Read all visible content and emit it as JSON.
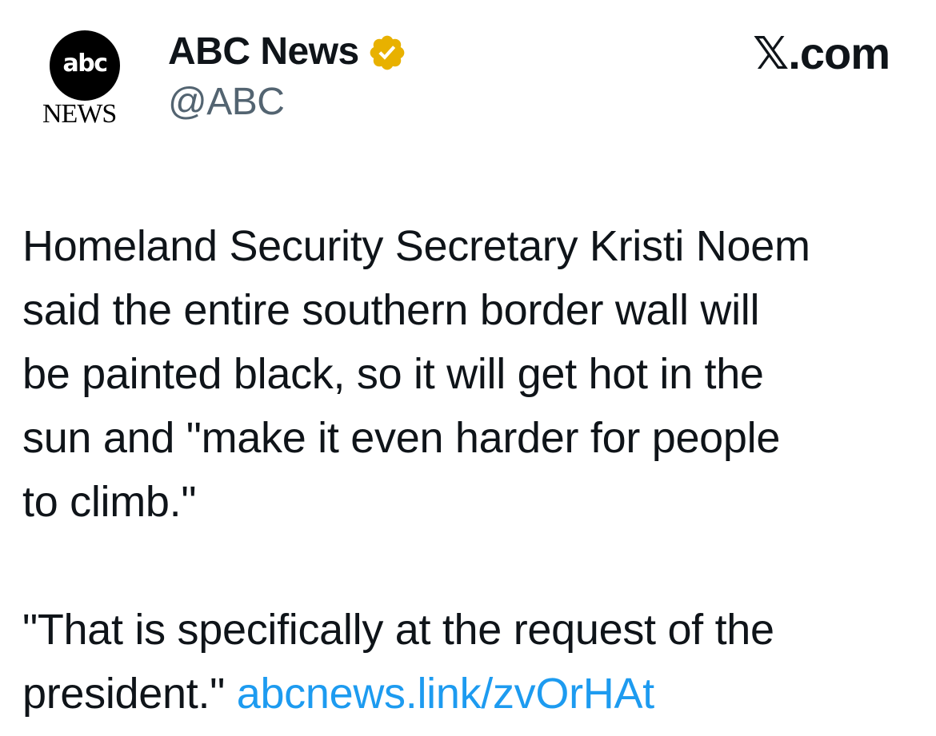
{
  "author": {
    "logo_top": "abc",
    "logo_bottom": "NEWS",
    "display_name": "ABC News",
    "handle": "@ABC",
    "verified_icon": "verified-badge-icon",
    "verified_color": "#e8b100"
  },
  "source": {
    "label": "𝕏.com"
  },
  "tweet": {
    "paragraph_1": "Homeland Security Secretary Kristi Noem\nsaid the entire southern border wall will\nbe painted black, so it will get hot in the\nsun and \"make it even harder for people\nto climb.\"",
    "paragraph_2_text": "\"That is specifically at the request of the\npresident.\" ",
    "link_text": "abcnews.link/zvOrHAt",
    "link_color": "#1d9bf0"
  }
}
